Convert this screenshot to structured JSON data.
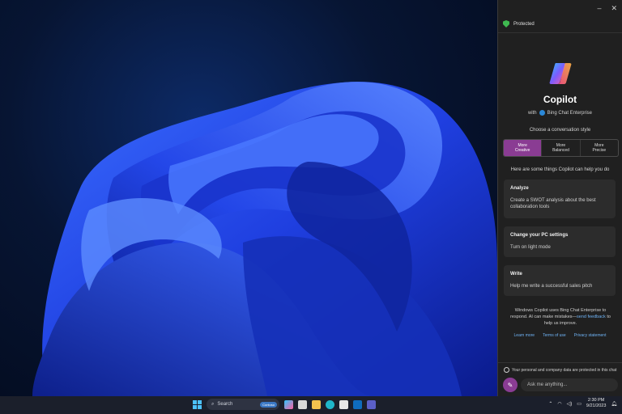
{
  "window": {
    "minimize_glyph": "–",
    "close_glyph": "✕"
  },
  "panel": {
    "status": "Protected",
    "app_title": "Copilot",
    "with_label": "with",
    "with_product": "Bing Chat Enterprise",
    "style_prompt": "Choose a conversation style",
    "styles": [
      {
        "label": "More\nCreative",
        "active": true
      },
      {
        "label": "More\nBalanced",
        "active": false
      },
      {
        "label": "More\nPrecise",
        "active": false
      }
    ],
    "intro": "Here are some things Copilot can help you do",
    "cards": [
      {
        "heading": "Analyze",
        "body": "Create a SWOT analysis about the best collaboration tools"
      },
      {
        "heading": "Change your PC settings",
        "body": "Turn on light mode"
      },
      {
        "heading": "Write",
        "body": "Help me write a successful sales pitch"
      }
    ],
    "disclaimer_pre": "Windows Copilot uses Bing Chat Enterprise to respond. AI can make mistakes—",
    "disclaimer_link": "send feedback",
    "disclaimer_post": " to help us improve.",
    "links": [
      "Learn more",
      "Terms of use",
      "Privacy statement"
    ],
    "privacy_note": "Your personal and company data are protected in this chat",
    "ask_placeholder": "Ask me anything..."
  },
  "taskbar": {
    "search_label": "Search",
    "search_badge": "Contoso",
    "time": "2:30 PM",
    "date": "9/21/2023"
  },
  "colors": {
    "accent": "#8a3c93",
    "shield": "#3fb950",
    "link": "#6fb3f5"
  }
}
